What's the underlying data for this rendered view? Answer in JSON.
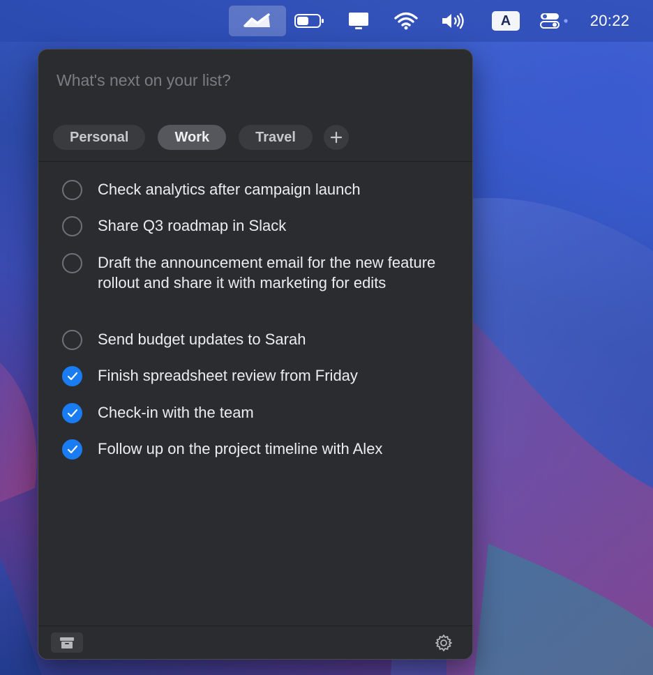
{
  "menubar": {
    "clock": "20:22",
    "keyboard_input": "A",
    "icons": [
      "app-checkmark-icon",
      "battery-icon",
      "display-icon",
      "wifi-icon",
      "volume-icon",
      "keyboard-input-icon",
      "control-center-icon"
    ]
  },
  "panel": {
    "input_placeholder": "What's next on your list?",
    "tabs": [
      {
        "label": "Personal",
        "active": false
      },
      {
        "label": "Work",
        "active": true
      },
      {
        "label": "Travel",
        "active": false
      }
    ],
    "tasks": [
      {
        "text": "Check analytics after campaign launch",
        "done": false
      },
      {
        "text": "Share Q3 roadmap in Slack",
        "done": false
      },
      {
        "text": "Draft the announcement email for the new feature rollout and share it with marketing for edits",
        "done": false
      },
      {
        "text": "Send budget updates to Sarah",
        "done": false
      },
      {
        "text": "Finish spreadsheet review from Friday",
        "done": true
      },
      {
        "text": "Check-in with the team",
        "done": true
      },
      {
        "text": "Follow up on the project timeline with Alex",
        "done": true
      }
    ],
    "colors": {
      "panel_bg": "#2b2c2f",
      "check_done": "#1a7cf2",
      "tab_active": "#55575c"
    }
  }
}
